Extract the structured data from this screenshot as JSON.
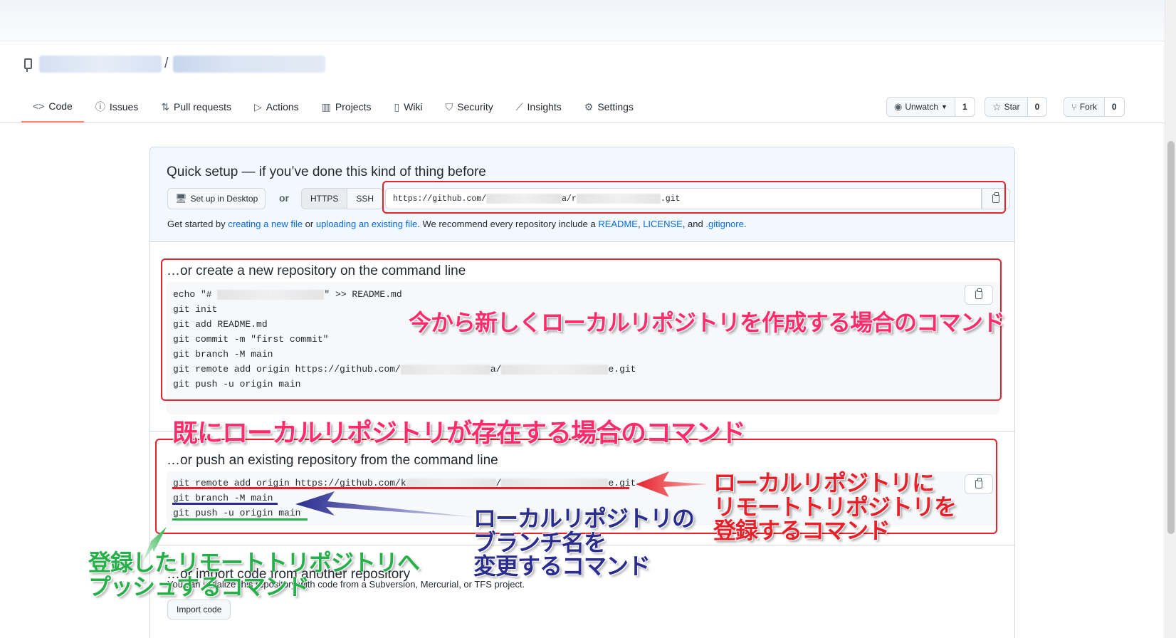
{
  "repo_header": {
    "separator": "/",
    "watch": {
      "label": "Unwatch",
      "count": "1"
    },
    "star": {
      "label": "Star",
      "count": "0"
    },
    "fork": {
      "label": "Fork",
      "count": "0"
    }
  },
  "tabs": [
    {
      "label": "Code",
      "icon": "code-icon"
    },
    {
      "label": "Issues",
      "icon": "issue-icon"
    },
    {
      "label": "Pull requests",
      "icon": "pull-request-icon"
    },
    {
      "label": "Actions",
      "icon": "play-icon"
    },
    {
      "label": "Projects",
      "icon": "project-icon"
    },
    {
      "label": "Wiki",
      "icon": "book-icon"
    },
    {
      "label": "Security",
      "icon": "shield-icon"
    },
    {
      "label": "Insights",
      "icon": "graph-icon"
    },
    {
      "label": "Settings",
      "icon": "gear-icon"
    }
  ],
  "quick_setup": {
    "title": "Quick setup — if you’ve done this kind of thing before",
    "setup_desktop": "Set up in Desktop",
    "or": "or",
    "https": "HTTPS",
    "ssh": "SSH",
    "url_prefix": "https://github.com/",
    "url_mid": "a/r",
    "url_suffix": ".git",
    "get_started": {
      "t1": "Get started by ",
      "l1": "creating a new file",
      "t2": " or ",
      "l2": "uploading an existing file",
      "t3": ". We recommend every repository include a ",
      "l3": "README",
      "t4": ", ",
      "l4": "LICENSE",
      "t5": ", and ",
      "l5": ".gitignore",
      "t6": "."
    }
  },
  "create_section": {
    "title": "…or create a new repository on the command line",
    "line1a": "echo \"# ",
    "line1b": "\" >> README.md",
    "line2": "git init",
    "line3": "git add README.md",
    "line4": "git commit -m \"first commit\"",
    "line5": "git branch -M main",
    "line6a": "git remote add origin https://github.com/",
    "line6b": "a/",
    "line6c": "e.git",
    "line7": "git push -u origin main"
  },
  "push_section": {
    "title": "…or push an existing repository from the command line",
    "line1a": "git remote add origin https://github.com/k",
    "line1b": "/",
    "line1c": "e.git",
    "line2": "git branch -M main",
    "line3": "git push -u origin main"
  },
  "import_section": {
    "title": "…or import code from another repository",
    "desc": "You can initialize this repository with code from a Subversion, Mercurial, or TFS project.",
    "button": "Import code"
  },
  "annotations": {
    "create_cmd": "今から新しくローカルリポジトリを作成する場合のコマンド",
    "existing_cmd": "既にローカルリポジトリが存在する場合のコマンド",
    "register_remote": [
      "ローカルリポジトリに",
      "リモートトリポジトリを",
      "登録するコマンド"
    ],
    "rename_branch": [
      "ローカルリポジトリの",
      "ブランチ名を",
      "変更するコマンド"
    ],
    "push_remote": [
      "登録したリモートトリポジトリへ",
      "プッシュするコマンド"
    ]
  },
  "colors": {
    "annotation_red": "#e8202a",
    "annotation_pink": "#ff2b6a",
    "annotation_navy": "#2a2d8f",
    "annotation_green": "#25b04a",
    "link": "#0969da"
  }
}
